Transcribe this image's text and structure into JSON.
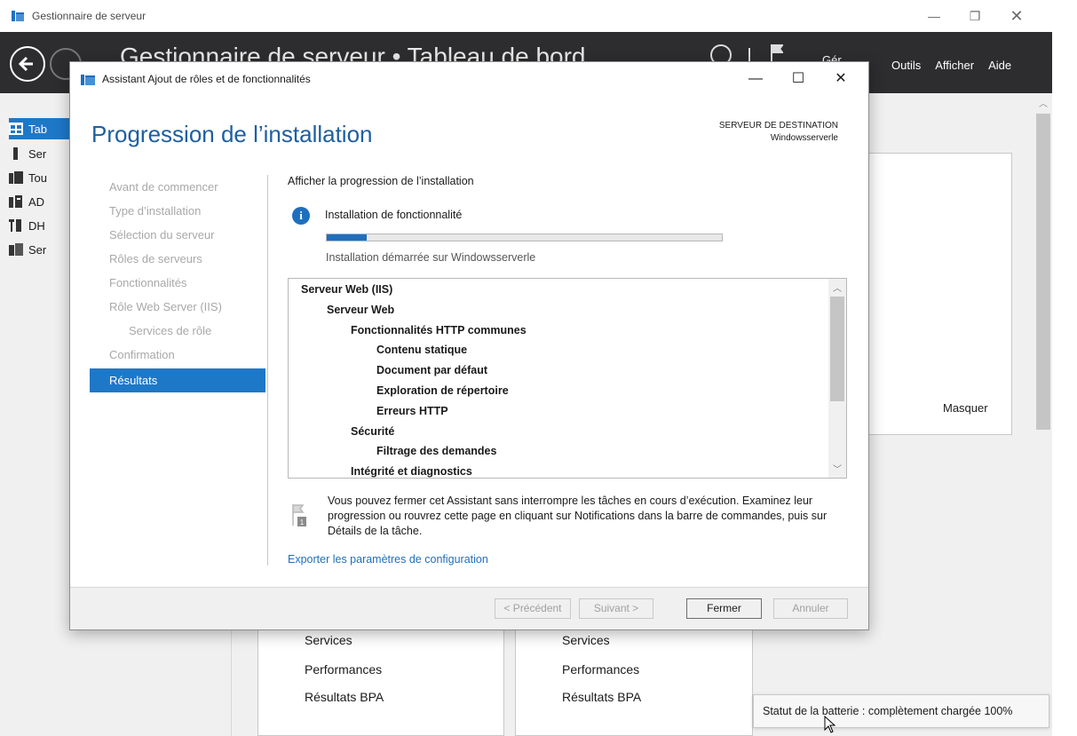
{
  "server_manager": {
    "title": "Gestionnaire de serveur",
    "breadcrumb": "Gestionnaire de serveur • Tableau de bord",
    "manage_partial": "Gér",
    "menu": [
      "Outils",
      "Afficher",
      "Aide"
    ],
    "sidebar": [
      {
        "label": "Tab",
        "icon": "dashboard-icon",
        "selected": true
      },
      {
        "label": "Ser",
        "icon": "local-server-icon"
      },
      {
        "label": "Tou",
        "icon": "all-servers-icon"
      },
      {
        "label": "AD",
        "icon": "ad-icon"
      },
      {
        "label": "DH",
        "icon": "dhcp-icon"
      },
      {
        "label": "Ser",
        "icon": "file-services-icon"
      }
    ],
    "hide_label": "Masquer",
    "tiles": [
      {
        "items": [
          "Services",
          "Performances",
          "Résultats BPA"
        ]
      },
      {
        "items": [
          "Services",
          "Performances",
          "Résultats BPA"
        ]
      }
    ]
  },
  "wizard": {
    "title": "Assistant Ajout de rôles et de fonctionnalités",
    "heading": "Progression de l’installation",
    "dest_label": "SERVEUR DE DESTINATION",
    "dest_server": "Windowsserverle",
    "steps": [
      {
        "label": "Avant de commencer",
        "sub": false
      },
      {
        "label": "Type d’installation",
        "sub": false
      },
      {
        "label": "Sélection du serveur",
        "sub": false
      },
      {
        "label": "Rôles de serveurs",
        "sub": false
      },
      {
        "label": "Fonctionnalités",
        "sub": false
      },
      {
        "label": "Rôle Web Server (IIS)",
        "sub": false
      },
      {
        "label": "Services de rôle",
        "sub": true
      },
      {
        "label": "Confirmation",
        "sub": false
      },
      {
        "label": "Résultats",
        "sub": false,
        "active": true
      }
    ],
    "progress_title": "Afficher la progression de l’installation",
    "feature_install": "Installation de fonctionnalité",
    "progress": 0.1,
    "started_on": "Installation démarrée sur Windowsserverle",
    "features": [
      {
        "label": "Serveur Web (IIS)",
        "level": 0
      },
      {
        "label": "Serveur Web",
        "level": 1
      },
      {
        "label": "Fonctionnalités HTTP communes",
        "level": 2
      },
      {
        "label": "Contenu statique",
        "level": 3
      },
      {
        "label": "Document par défaut",
        "level": 3
      },
      {
        "label": "Exploration de répertoire",
        "level": 3
      },
      {
        "label": "Erreurs HTTP",
        "level": 3
      },
      {
        "label": "Sécurité",
        "level": 2
      },
      {
        "label": "Filtrage des demandes",
        "level": 3
      },
      {
        "label": "Intégrité et diagnostics",
        "level": 2
      }
    ],
    "note": "Vous pouvez fermer cet Assistant sans interrompre les tâches en cours d’exécution. Examinez leur progression ou rouvrez cette page en cliquant sur Notifications dans la barre de commandes, puis sur Détails de la tâche.",
    "notification_count": "1",
    "export_link": "Exporter les paramètres de configuration",
    "buttons": {
      "prev": "< Précédent",
      "next": "Suivant >",
      "close": "Fermer",
      "cancel": "Annuler"
    }
  },
  "tooltip": "Statut de la batterie : complètement chargée 100%",
  "colors": {
    "accent": "#1e78c8",
    "header": "#2d2d30",
    "link": "#1e6fbf"
  }
}
